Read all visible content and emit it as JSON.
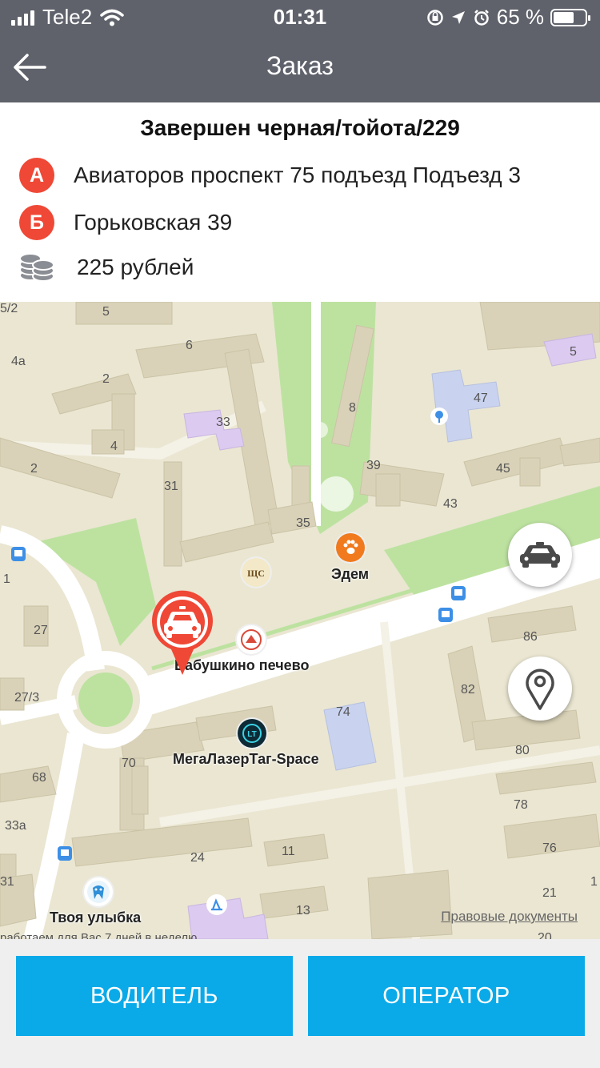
{
  "status_bar": {
    "carrier": "Tele2",
    "time": "01:31",
    "battery": "65 %",
    "battery_level": 0.65
  },
  "header": {
    "title": "Заказ"
  },
  "order": {
    "status": "Завершен черная/тойота/229",
    "point_a": {
      "badge": "А",
      "address": "Авиаторов проспект 75 подъезд Подъезд 3"
    },
    "point_b": {
      "badge": "Б",
      "address": "Горьковская 39"
    },
    "price": "225 рублей"
  },
  "map": {
    "pois": {
      "edem": "Эдем",
      "babushkino": "Бабушкино печево",
      "megalaser": "МегаЛазерТаг-Space",
      "tvoya_ulybka": "Твоя улыбка",
      "cut_text": "работаем для Вас 7 дней в неделю"
    },
    "house_numbers": [
      "5/2",
      "5",
      "4а",
      "6",
      "2",
      "4",
      "2",
      "33",
      "31",
      "8",
      "39",
      "47",
      "45",
      "43",
      "5",
      "35",
      "27",
      "27/3",
      "1",
      "74",
      "82",
      "86",
      "80",
      "70",
      "68",
      "33а",
      "24",
      "11",
      "13",
      "78",
      "76",
      "21",
      "20",
      "31",
      "1"
    ],
    "legal_link": "Правовые документы",
    "colors": {
      "land": "#eae6d2",
      "building": "#d9d2b8",
      "park": "#bde2a0",
      "road": "#ffffff",
      "school": "#c9d3ef",
      "hospital": "#dccaf0"
    }
  },
  "footer": {
    "driver_button": "ВОДИТЕЛЬ",
    "operator_button": "ОПЕРАТОР"
  },
  "colors": {
    "header_bg": "#5f626b",
    "accent_red": "#ef4836",
    "button_blue": "#0aaae9"
  }
}
